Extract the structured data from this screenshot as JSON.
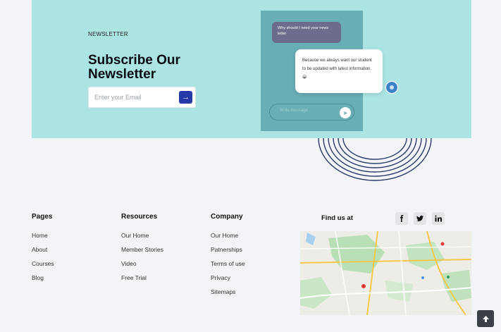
{
  "newsletter": {
    "kicker": "NEWSLETTER",
    "title": "Subscribe Our Newsletter",
    "email_placeholder": "Enter your Email",
    "submit_icon": "arrow-right-icon"
  },
  "chat": {
    "question": "Why should I need your news letter",
    "answer": "Because we always want our student to be updated with latest information. 😀",
    "compose_placeholder": "Write message...",
    "send_icon": "send-icon"
  },
  "footer": {
    "pages": {
      "title": "Pages",
      "items": [
        "Home",
        "About",
        "Courses",
        "Blog"
      ]
    },
    "resources": {
      "title": "Resources",
      "items": [
        "Our Home",
        "Member Stories",
        "Video",
        "Free Trial"
      ]
    },
    "company": {
      "title": "Company",
      "items": [
        "Our Home",
        "Patnerships",
        "Terms of use",
        "Privacy",
        "Sitemaps"
      ]
    },
    "find_us": {
      "title": "Find us at",
      "social": [
        "facebook-icon",
        "twitter-icon",
        "linkedin-icon"
      ]
    }
  },
  "colors": {
    "band": "#abe4e2",
    "accent": "#2639a8",
    "chat_panel": "#68aeb4"
  },
  "back_to_top_icon": "arrow-up-icon"
}
